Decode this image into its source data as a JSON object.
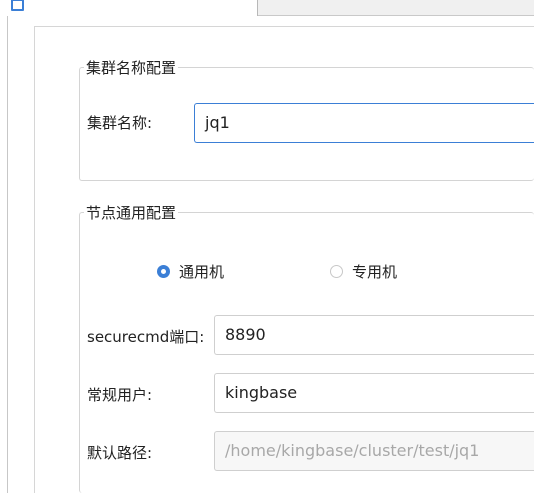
{
  "tab": {
    "label": ""
  },
  "cluster_group": {
    "title": "集群名称配置",
    "name_label": "集群名称:",
    "name_value": "jq1"
  },
  "node_group": {
    "title": "节点通用配置",
    "radio_general": "通用机",
    "radio_dedicated": "专用机",
    "selected": "通用机",
    "port_label": "securecmd端口:",
    "port_value": "8890",
    "user_label": "常规用户:",
    "user_value": "kingbase",
    "path_label": "默认路径:",
    "path_value": "/home/kingbase/cluster/test/jq1"
  },
  "colors": {
    "accent": "#3b7fd6",
    "border": "#d4d4d4",
    "disabled_text": "#a8a8a8"
  }
}
